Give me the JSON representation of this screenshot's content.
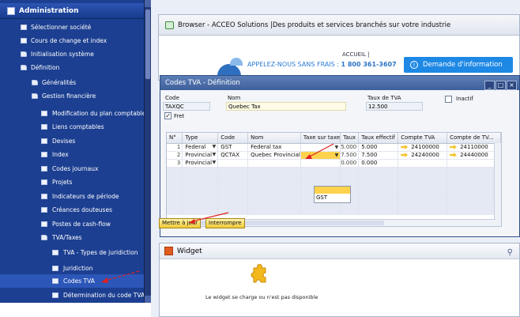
{
  "sidebar": {
    "header": "Administration",
    "items": [
      {
        "label": "Sélectionner société"
      },
      {
        "label": "Cours de change et index"
      },
      {
        "label": "Initialisation système"
      },
      {
        "label": "Définition"
      },
      {
        "label": "Généralités"
      },
      {
        "label": "Gestion financière"
      },
      {
        "label": "Modification du plan comptable"
      },
      {
        "label": "Liens comptables"
      },
      {
        "label": "Devises"
      },
      {
        "label": "Index"
      },
      {
        "label": "Codes journaux"
      },
      {
        "label": "Projets"
      },
      {
        "label": "Indicateurs de période"
      },
      {
        "label": "Créances douteuses"
      },
      {
        "label": "Postes de cash-flow"
      },
      {
        "label": "TVA/Taxes"
      },
      {
        "label": "TVA - Types de juridiction"
      },
      {
        "label": "Juridiction"
      },
      {
        "label": "Codes TVA"
      },
      {
        "label": "Détermination du code TVA"
      }
    ]
  },
  "browser": {
    "title": "Browser - ACCEO Solutions |Des produits et services branchés sur votre industrie",
    "nav_accueil": "ACCUEIL  |",
    "phone_text": "APPELEZ-NOUS SANS FRAIS : ",
    "phone_number": "1 800 361-3607",
    "demande_label": "Demande d'information"
  },
  "codes_tva": {
    "title": "Codes TVA - Définition",
    "code_label": "Code",
    "code_value": "TAXQC",
    "nom_label": "Nom",
    "nom_value": "Quebec Tax",
    "taux_label": "Taux de TVA",
    "taux_value": "12.500",
    "inactif_label": "Inactif",
    "fret_label": "Fret",
    "fret_checked": true,
    "columns": [
      "N°",
      "Type",
      "Code",
      "Nom",
      "Taxe sur taxe",
      "Taux",
      "Taux effectif",
      "Compte TVA",
      "Compte de TV..."
    ],
    "rows": [
      {
        "n": "1",
        "type": "Federal",
        "code": "GST",
        "nom": "Federal tax",
        "taxe": "",
        "taux": "5.000",
        "taux_eff": "5.000",
        "compte": "24100000",
        "compte2": "24110000"
      },
      {
        "n": "2",
        "type": "Provincial",
        "code": "QCTAX",
        "nom": "Quebec Provincial",
        "taxe": "",
        "taux": "7.500",
        "taux_eff": "7.500",
        "compte": "24240000",
        "compte2": "24440000"
      },
      {
        "n": "3",
        "type": "Provincial",
        "code": "",
        "nom": "",
        "taxe": "",
        "taux": "0.000",
        "taux_eff": "0.000",
        "compte": "",
        "compte2": ""
      }
    ],
    "dropdown_option": "GST",
    "update_button": "Mettre à jour",
    "cancel_button": "Interrompre"
  },
  "widget": {
    "title": "Widget",
    "message": "Le widget se charge ou n'est pas disponible"
  },
  "colors": {
    "sidebar_bg": "#1c3f91",
    "highlight": "#ffd24d",
    "arrow": "#e02020",
    "accent_blue": "#1e88e5"
  }
}
